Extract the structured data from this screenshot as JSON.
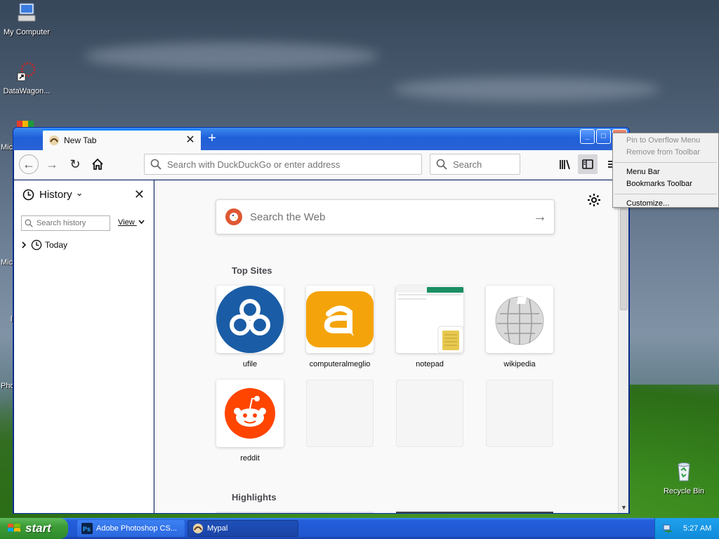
{
  "desktop": {
    "icons": [
      {
        "label": "My Computer"
      },
      {
        "label": "DataWagon..."
      },
      {
        "label": "Recycle Bin"
      }
    ],
    "partial_labels": [
      "Mic",
      "Mic",
      "l",
      "Pho"
    ]
  },
  "browser": {
    "tab": {
      "title": "New Tab",
      "close_glyph": "✕"
    },
    "new_tab_glyph": "+",
    "window_controls": {
      "minimize": "_",
      "maximize": "□",
      "close": "✕"
    },
    "nav": {
      "back_glyph": "←",
      "forward_glyph": "→",
      "reload_glyph": "↻",
      "home_icon": "home-icon"
    },
    "urlbar": {
      "placeholder": "Search with DuckDuckGo or enter address"
    },
    "searchbar": {
      "placeholder": "Search"
    },
    "sidebar": {
      "title": "History",
      "title_chevron": "⌄",
      "close_glyph": "✕",
      "search_placeholder": "Search history",
      "view_label": "View",
      "items": [
        {
          "label": "Today"
        }
      ]
    },
    "content": {
      "search_placeholder": "Search the Web",
      "search_arrow": "→",
      "top_sites_title": "Top Sites",
      "highlights_title": "Highlights",
      "top_sites": [
        {
          "label": "ufile",
          "color": "#1a5da6"
        },
        {
          "label": "computeralmeglio",
          "color": "#f4a40a"
        },
        {
          "label": "notepad",
          "color": "#e7c94f"
        },
        {
          "label": "wikipedia",
          "color": "#cccccc"
        },
        {
          "label": "reddit",
          "color": "#ff4500"
        },
        {
          "label": ""
        },
        {
          "label": ""
        },
        {
          "label": ""
        }
      ]
    }
  },
  "context_menu": {
    "items": [
      {
        "label": "Pin to Overflow Menu",
        "disabled": true
      },
      {
        "label": "Remove from Toolbar",
        "disabled": true
      },
      {
        "label": "Menu Bar",
        "disabled": false
      },
      {
        "label": "Bookmarks Toolbar",
        "disabled": false
      },
      {
        "label": "Customize...",
        "disabled": false
      }
    ]
  },
  "taskbar": {
    "start_label": "start",
    "tasks": [
      {
        "label": "Adobe Photoshop CS..."
      },
      {
        "label": "Mypal"
      }
    ],
    "clock": "5:27 AM"
  },
  "colors": {
    "accent": "#0a84ff",
    "xp_blue": "#245edb",
    "xp_green": "#3c9b37"
  }
}
